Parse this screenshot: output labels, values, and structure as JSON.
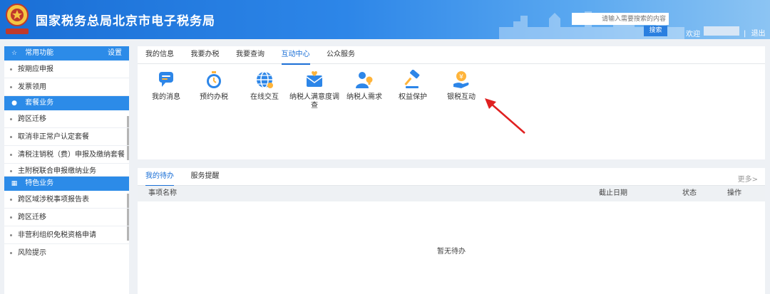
{
  "header": {
    "title": "国家税务总局北京市电子税务局",
    "emblem_text": "中国税务",
    "search_placeholder": "请输入需要搜索的内容",
    "search_button": "搜索",
    "welcome": "欢迎",
    "separator": "|",
    "logout": "退出",
    "gradient_colors": [
      "#1a6fd6",
      "#8cc4f3"
    ]
  },
  "sidebar": {
    "sections": [
      {
        "title": "常用功能",
        "icon": "star-icon",
        "extra": "设置",
        "items": [
          "按期应申报",
          "发票领用"
        ]
      },
      {
        "title": "套餐业务",
        "icon": "package-icon",
        "items": [
          "跨区迁移",
          "取消非正常户认定套餐",
          "清税注销税（费）申报及缴纳套餐",
          "主附税联合申报缴纳业务"
        ]
      },
      {
        "title": "特色业务",
        "icon": "grid-icon",
        "items": [
          "跨区域涉税事项报告表",
          "跨区迁移",
          "非营利组织免税资格申请",
          "风险提示"
        ]
      }
    ],
    "accent_color": "#2c8be8"
  },
  "top_tabs": [
    "我的信息",
    "我要办税",
    "我要查询",
    "互动中心",
    "公众服务"
  ],
  "top_tabs_active": "互动中心",
  "tools": [
    {
      "label": "我的消息",
      "icon": "message-icon"
    },
    {
      "label": "预约办税",
      "icon": "stopwatch-icon"
    },
    {
      "label": "在线交互",
      "icon": "globe-icon"
    },
    {
      "label": "纳税人满意度调查",
      "icon": "survey-envelope-icon"
    },
    {
      "label": "纳税人需求",
      "icon": "person-lightbulb-icon"
    },
    {
      "label": "权益保护",
      "icon": "gavel-icon"
    },
    {
      "label": "银税互动",
      "icon": "coin-hand-icon"
    }
  ],
  "bottom_tabs": [
    "我的待办",
    "服务提醒"
  ],
  "bottom_tabs_active": "我的待办",
  "more": "更多>",
  "table": {
    "columns": [
      "事项名称",
      "截止日期",
      "状态",
      "操作"
    ],
    "empty_text": "暂无待办"
  },
  "annotation_arrow_color": "#e02020"
}
